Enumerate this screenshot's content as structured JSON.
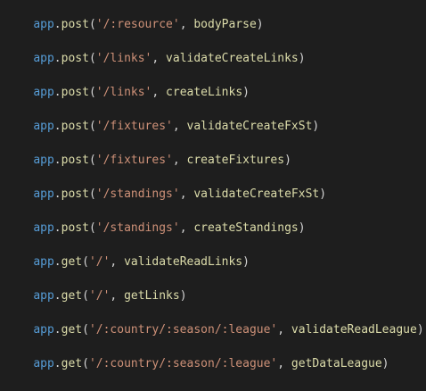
{
  "colors": {
    "background": "#1e1e1e",
    "object": "#569cd6",
    "method": "#dcdcaa",
    "punctuation": "#d4d4d4",
    "string": "#ce9178",
    "identifier": "#dcdcaa"
  },
  "lines": [
    {
      "obj": "app",
      "method": "post",
      "path": "'/:resource'",
      "handler": "bodyParse"
    },
    {
      "obj": "app",
      "method": "post",
      "path": "'/links'",
      "handler": "validateCreateLinks"
    },
    {
      "obj": "app",
      "method": "post",
      "path": "'/links'",
      "handler": "createLinks"
    },
    {
      "obj": "app",
      "method": "post",
      "path": "'/fixtures'",
      "handler": "validateCreateFxSt"
    },
    {
      "obj": "app",
      "method": "post",
      "path": "'/fixtures'",
      "handler": "createFixtures"
    },
    {
      "obj": "app",
      "method": "post",
      "path": "'/standings'",
      "handler": "validateCreateFxSt"
    },
    {
      "obj": "app",
      "method": "post",
      "path": "'/standings'",
      "handler": "createStandings"
    },
    {
      "obj": "app",
      "method": "get",
      "path": "'/'",
      "handler": "validateReadLinks"
    },
    {
      "obj": "app",
      "method": "get",
      "path": "'/'",
      "handler": "getLinks"
    },
    {
      "obj": "app",
      "method": "get",
      "path": "'/:country/:season/:league'",
      "handler": "validateReadLeague"
    },
    {
      "obj": "app",
      "method": "get",
      "path": "'/:country/:season/:league'",
      "handler": "getDataLeague"
    }
  ]
}
